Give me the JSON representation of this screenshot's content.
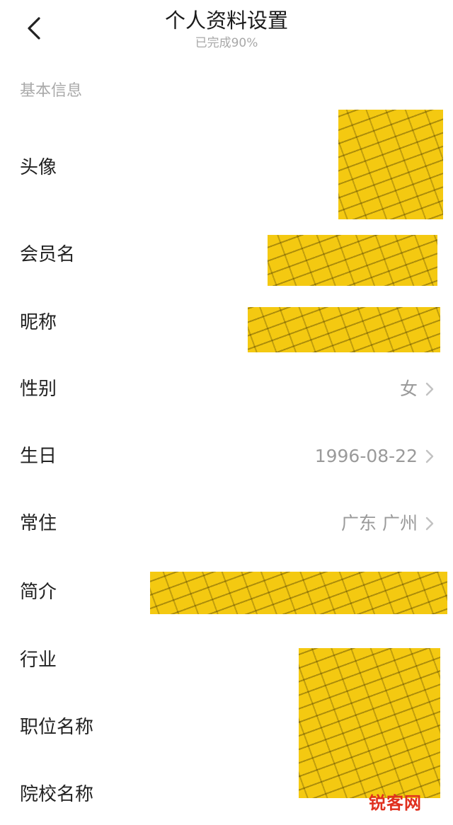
{
  "header": {
    "title": "个人资料设置",
    "subtitle": "已完成90%",
    "back_icon": "chevron-left-icon"
  },
  "section": {
    "label": "基本信息"
  },
  "rows": {
    "avatar": {
      "label": "头像"
    },
    "member_name": {
      "label": "会员名"
    },
    "nickname": {
      "label": "昵称"
    },
    "gender": {
      "label": "性别",
      "value": "女"
    },
    "birthday": {
      "label": "生日",
      "value": "1996-08-22"
    },
    "residence": {
      "label": "常住",
      "value": "广东 广州"
    },
    "intro": {
      "label": "简介"
    },
    "industry": {
      "label": "行业"
    },
    "position": {
      "label": "职位名称"
    },
    "school": {
      "label": "院校名称"
    }
  },
  "colors": {
    "redaction": "#f4c911",
    "label": "#222222",
    "value": "#9a9a9a",
    "section": "#a9a9a9"
  },
  "watermark": {
    "text": "锐客网"
  }
}
